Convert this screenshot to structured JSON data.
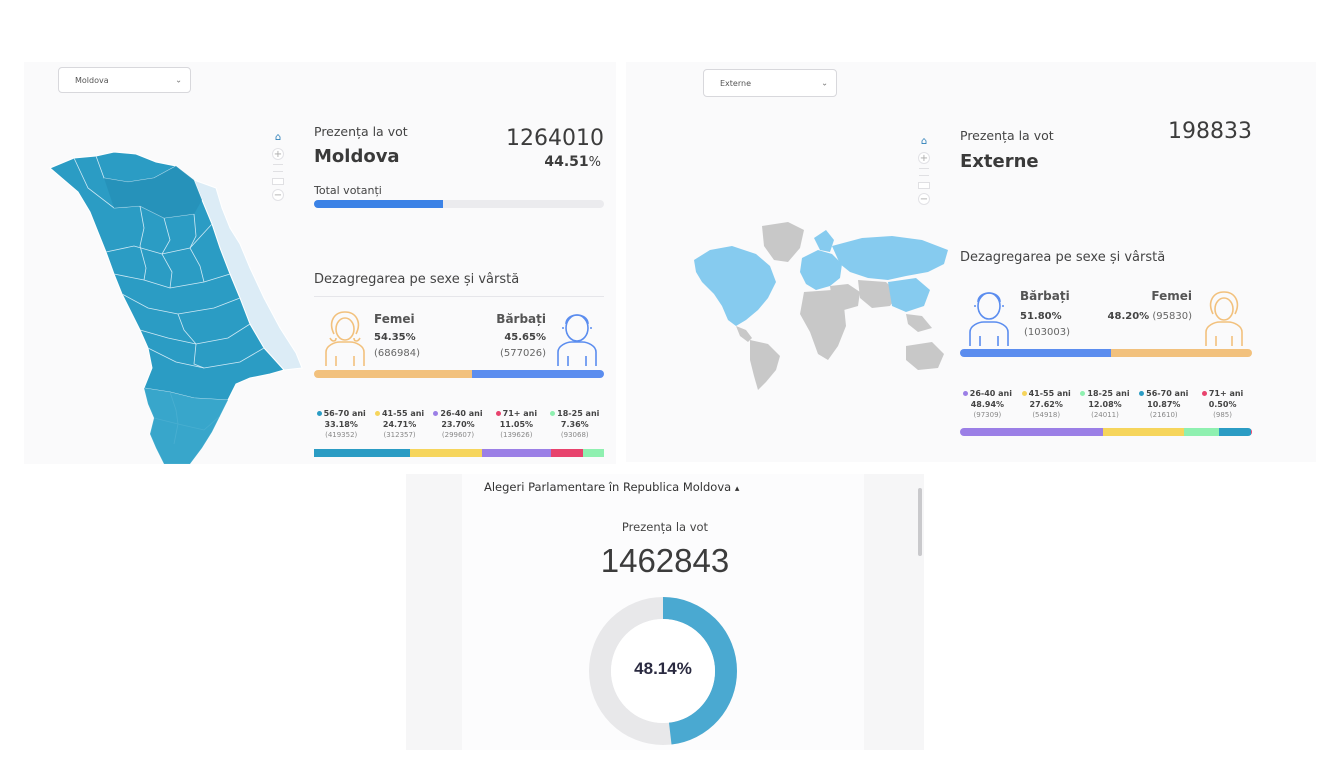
{
  "moldova": {
    "select_value": "Moldova",
    "turnout_label": "Prezența la vot",
    "region_name": "Moldova",
    "total_votes": "1264010",
    "percent_value": "44.51",
    "percent_sign": "%",
    "total_label": "Total votanți",
    "total_progress": 0.4451,
    "section_title": "Dezagregarea pe sexe și vârstă",
    "women": {
      "label": "Femei",
      "percent": "54.35%",
      "count": "(686984)",
      "share": 0.5435
    },
    "men": {
      "label": "Bărbați",
      "percent": "45.65%",
      "count": "(577026)",
      "share": 0.4565
    },
    "age_groups": [
      {
        "label": "56-70 ani",
        "percent": "33.18%",
        "count": "(419352)",
        "color": "#2b9cc4",
        "share": 0.3318
      },
      {
        "label": "41-55 ani",
        "percent": "24.71%",
        "count": "(312357)",
        "color": "#f6d55c",
        "share": 0.2471
      },
      {
        "label": "26-40 ani",
        "percent": "23.70%",
        "count": "(299607)",
        "color": "#9b7fe6",
        "share": 0.237
      },
      {
        "label": "71+ ani",
        "percent": "11.05%",
        "count": "(139626)",
        "color": "#e8436d",
        "share": 0.1105
      },
      {
        "label": "18-25 ani",
        "percent": "7.36%",
        "count": "(93068)",
        "color": "#8ff0b0",
        "share": 0.0736
      }
    ]
  },
  "externe": {
    "select_value": "Externe",
    "turnout_label": "Prezența la vot",
    "region_name": "Externe",
    "total_votes": "198833",
    "section_title": "Dezagregarea pe sexe și vârstă",
    "men": {
      "label": "Bărbați",
      "percent": "51.80%",
      "count": "(103003)",
      "share": 0.518
    },
    "women": {
      "label": "Femei",
      "percent": "48.20%",
      "count": "(95830)",
      "share": 0.482
    },
    "age_groups": [
      {
        "label": "26-40 ani",
        "percent": "48.94%",
        "count": "(97309)",
        "color": "#9b7fe6",
        "share": 0.4894
      },
      {
        "label": "41-55 ani",
        "percent": "27.62%",
        "count": "(54918)",
        "color": "#f6d55c",
        "share": 0.2762
      },
      {
        "label": "18-25 ani",
        "percent": "12.08%",
        "count": "(24011)",
        "color": "#8ff0b0",
        "share": 0.1208
      },
      {
        "label": "56-70 ani",
        "percent": "10.87%",
        "count": "(21610)",
        "color": "#2b9cc4",
        "share": 0.1087
      },
      {
        "label": "71+ ani",
        "percent": "0.50%",
        "count": "(985)",
        "color": "#e8436d",
        "share": 0.005
      }
    ]
  },
  "summary": {
    "header_title": "Alegeri Parlamentare în Republica Moldova",
    "caret": "▴",
    "turnout_label": "Prezența la vot",
    "total_votes": "1462843",
    "percent_label": "48.14%",
    "percent_value": 0.4814
  },
  "colors": {
    "women": "#f2c17d",
    "men": "#5b8def",
    "map_moldova": "#2b9cc4",
    "map_abroad": "#86cbef",
    "map_other": "#c8c8c8",
    "donut": "#4aa9d1",
    "donut_track": "#e8e8ea"
  },
  "icons": {
    "home": "home-icon",
    "zoom_in": "plus-icon",
    "zoom_out": "minus-icon",
    "chevron": "chevron-down-icon"
  }
}
